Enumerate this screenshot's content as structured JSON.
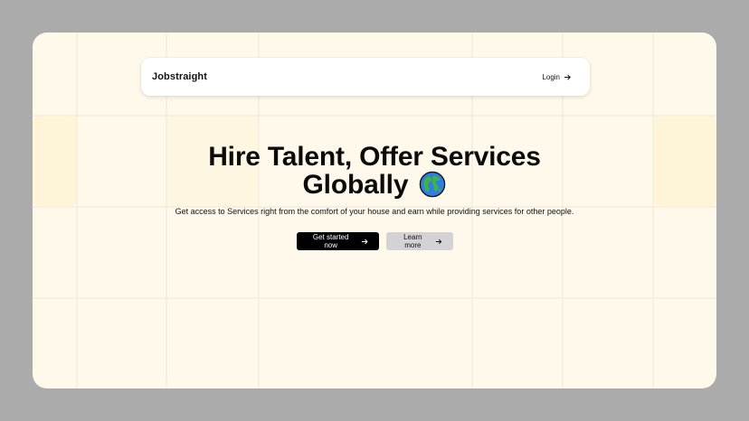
{
  "brand": {
    "name": "Jobstraight"
  },
  "nav": {
    "login_label": "Login"
  },
  "hero": {
    "headline_line1": "Hire Talent, Offer Services",
    "headline_line2": "Globally",
    "subtitle": "Get access to Services right from the comfort of your house and earn while providing services for other people."
  },
  "actions": {
    "primary_label": "Get started now",
    "secondary_label": "Learn more"
  },
  "icons": {
    "arrow": "arrow-right-icon",
    "globe": "globe-icon"
  },
  "colors": {
    "page_bg": "#ababab",
    "frame_bg": "#fef9ea",
    "primary_button": "#000000",
    "secondary_button": "#d3d3d6"
  }
}
